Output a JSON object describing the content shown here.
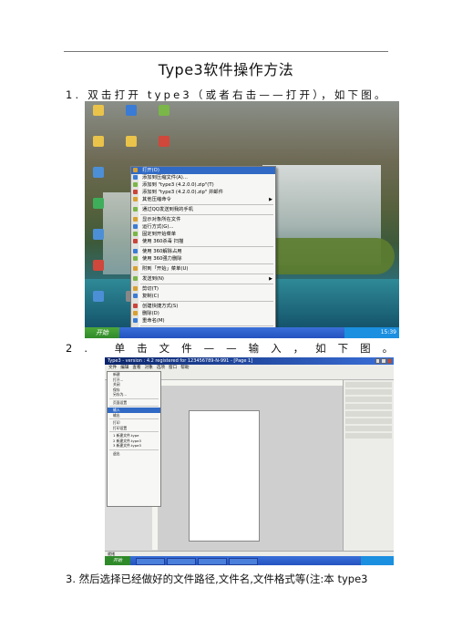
{
  "page": {
    "title": "Type3软件操作方法",
    "steps": [
      "1. 双击打开 type3（或者右击——打开），如下图。",
      "2. 单击文件——输入，如下图。",
      "3. 然后选择已经做好的文件路径,文件名,文件格式等(注:本 type3"
    ]
  },
  "screenshot1": {
    "start_label": "开始",
    "clock": "15:39",
    "context_menu": [
      {
        "label": "打开(O)",
        "highlight": true
      },
      {
        "label": "添加到压缩文件(A)..."
      },
      {
        "label": "添加到 \"type3 (4.2.0.0).zip\"(T)"
      },
      {
        "label": "添加到 \"type3 (4.2.0.0).zip\" 并邮件"
      },
      {
        "label": "其他压缩命令",
        "submenu": true
      },
      {
        "sep": true
      },
      {
        "label": "通过QQ发送到我的手机"
      },
      {
        "sep": true
      },
      {
        "label": "显示对象所在文件"
      },
      {
        "label": "运行方式(G)..."
      },
      {
        "label": "固定到开始菜单"
      },
      {
        "label": "使用 360杀毒 扫描"
      },
      {
        "sep": true
      },
      {
        "label": "使用 360解除占用"
      },
      {
        "label": "使用 360强力删除"
      },
      {
        "sep": true
      },
      {
        "label": "附到「开始」菜单(U)"
      },
      {
        "sep": true
      },
      {
        "label": "发送到(N)",
        "submenu": true
      },
      {
        "sep": true
      },
      {
        "label": "剪切(T)"
      },
      {
        "label": "复制(C)"
      },
      {
        "sep": true
      },
      {
        "label": "创建快捷方式(S)"
      },
      {
        "label": "删除(D)"
      },
      {
        "label": "重命名(M)"
      },
      {
        "sep": true
      },
      {
        "label": "属性(R)"
      }
    ]
  },
  "screenshot2": {
    "window_title": "Type3 - version : 4.2 registered for 123456789-N-991 - [Page 1]",
    "menubar": [
      "文件",
      "编辑",
      "查看",
      "对象",
      "选项",
      "窗口",
      "帮助"
    ],
    "file_menu": [
      {
        "label": "新建"
      },
      {
        "label": "打开..."
      },
      {
        "label": "关闭"
      },
      {
        "label": "保存"
      },
      {
        "label": "另存为..."
      },
      {
        "sep": true
      },
      {
        "label": "页面设置"
      },
      {
        "sep": true
      },
      {
        "label": "输入",
        "highlight": true
      },
      {
        "label": "输出"
      },
      {
        "sep": true
      },
      {
        "label": "打印"
      },
      {
        "label": "打印设置"
      },
      {
        "sep": true
      },
      {
        "label": "1 新建文件.type"
      },
      {
        "label": "2 新建文件.type3"
      },
      {
        "label": "3 新建文件.type3"
      },
      {
        "sep": true
      },
      {
        "label": "退出"
      }
    ],
    "status": "就绪"
  }
}
